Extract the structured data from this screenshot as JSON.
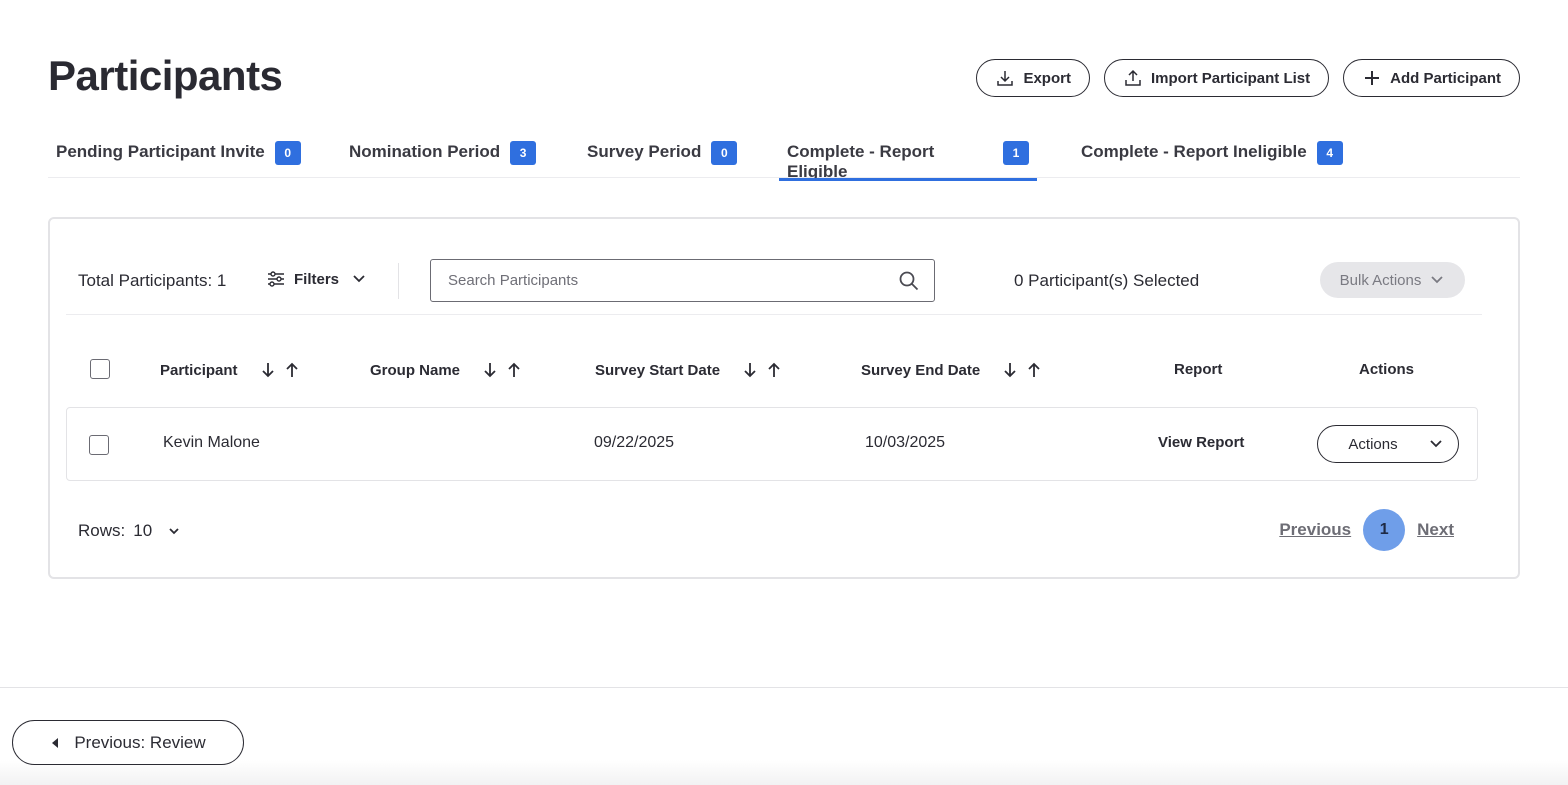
{
  "page": {
    "title": "Participants"
  },
  "top_actions": {
    "export": "Export",
    "import": "Import Participant List",
    "add": "Add Participant"
  },
  "tabs": [
    {
      "label": "Pending Participant Invite",
      "count": "0",
      "active": false
    },
    {
      "label": "Nomination Period",
      "count": "3",
      "active": false
    },
    {
      "label": "Survey Period",
      "count": "0",
      "active": false
    },
    {
      "label": "Complete - Report Eligible",
      "count": "1",
      "active": true
    },
    {
      "label": "Complete - Report Ineligible",
      "count": "4",
      "active": false
    }
  ],
  "toolbar": {
    "total": "Total Participants: 1",
    "filters": "Filters",
    "search_placeholder": "Search Participants",
    "selected": "0 Participant(s) Selected",
    "bulk_actions": "Bulk Actions"
  },
  "table": {
    "columns": {
      "participant": "Participant",
      "group": "Group Name",
      "start": "Survey Start Date",
      "end": "Survey End Date",
      "report": "Report",
      "actions": "Actions"
    },
    "rows": [
      {
        "participant": "Kevin Malone",
        "group": "",
        "start": "09/22/2025",
        "end": "10/03/2025",
        "report": "View Report",
        "actions": "Actions"
      }
    ]
  },
  "pagination": {
    "rows_label": "Rows:",
    "rows_value": "10",
    "previous": "Previous",
    "current_page": "1",
    "next": "Next"
  },
  "footer": {
    "previous_button": "Previous: Review"
  },
  "colors": {
    "accent": "#2f6fdf",
    "page_active": "#6f9ee9",
    "text": "#2b2b33"
  }
}
